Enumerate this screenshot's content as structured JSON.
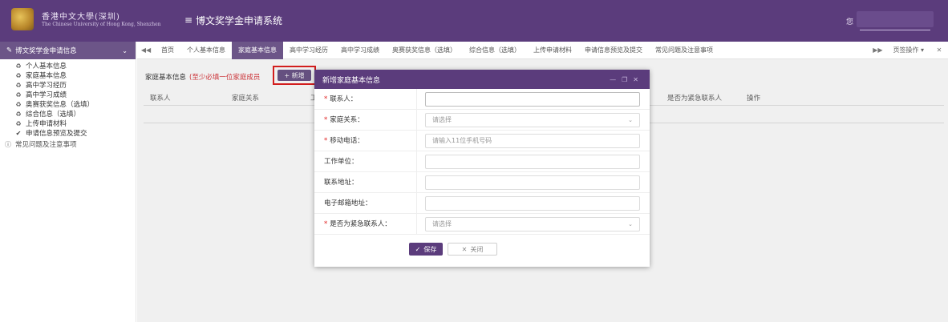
{
  "header": {
    "school_cn": "香港中文大學(深圳)",
    "school_en": "The Chinese University of Hong Kong, Shenzhen",
    "menu_icon": "≡",
    "system_title": "博文奖学金申请系统",
    "user_greeting": "您"
  },
  "sidebar": {
    "title": "博文奖学金申请信息",
    "items": [
      {
        "label": "个人基本信息",
        "icon": "recycle-icon"
      },
      {
        "label": "家庭基本信息",
        "icon": "recycle-icon"
      },
      {
        "label": "高中学习经历",
        "icon": "recycle-icon"
      },
      {
        "label": "高中学习成绩",
        "icon": "recycle-icon"
      },
      {
        "label": "奥赛获奖信息（选填）",
        "icon": "recycle-icon"
      },
      {
        "label": "综合信息（选填）",
        "icon": "recycle-icon"
      },
      {
        "label": "上传申请材料",
        "icon": "recycle-icon"
      },
      {
        "label": "申请信息预览及提交",
        "icon": "check-icon"
      }
    ],
    "help": "常见问题及注意事项"
  },
  "tabs": {
    "items": [
      "首页",
      "个人基本信息",
      "家庭基本信息",
      "高中学习经历",
      "高中学习成绩",
      "奥赛获奖信息（选填）",
      "综合信息（选填）",
      "上传申请材料",
      "申请信息预览及提交",
      "常见问题及注意事项"
    ],
    "active_index": 2,
    "page_ops": "页签操作"
  },
  "panel": {
    "title": "家庭基本信息",
    "note": "(至少必填一位家庭成员",
    "add_button": "+ 新增",
    "columns": [
      "联系人",
      "家庭关系",
      "工",
      "是否为紧急联系人",
      "操作"
    ]
  },
  "modal": {
    "title": "新增家庭基本信息",
    "fields": [
      {
        "label": "联系人：",
        "required": true,
        "type": "text",
        "value": ""
      },
      {
        "label": "家庭关系：",
        "required": true,
        "type": "select",
        "value": "请选择"
      },
      {
        "label": "移动电话：",
        "required": true,
        "type": "text",
        "value": "请输入11位手机号码"
      },
      {
        "label": "工作单位：",
        "required": false,
        "type": "text",
        "value": ""
      },
      {
        "label": "联系地址：",
        "required": false,
        "type": "text",
        "value": ""
      },
      {
        "label": "电子邮箱地址：",
        "required": false,
        "type": "text",
        "value": ""
      },
      {
        "label": "是否为紧急联系人：",
        "required": true,
        "type": "select",
        "value": "请选择"
      }
    ],
    "save_label": "保存",
    "close_label": "关闭"
  },
  "colors": {
    "brand_purple": "#5b3c7c",
    "tab_active": "#6c5588",
    "required_red": "#e02020"
  }
}
